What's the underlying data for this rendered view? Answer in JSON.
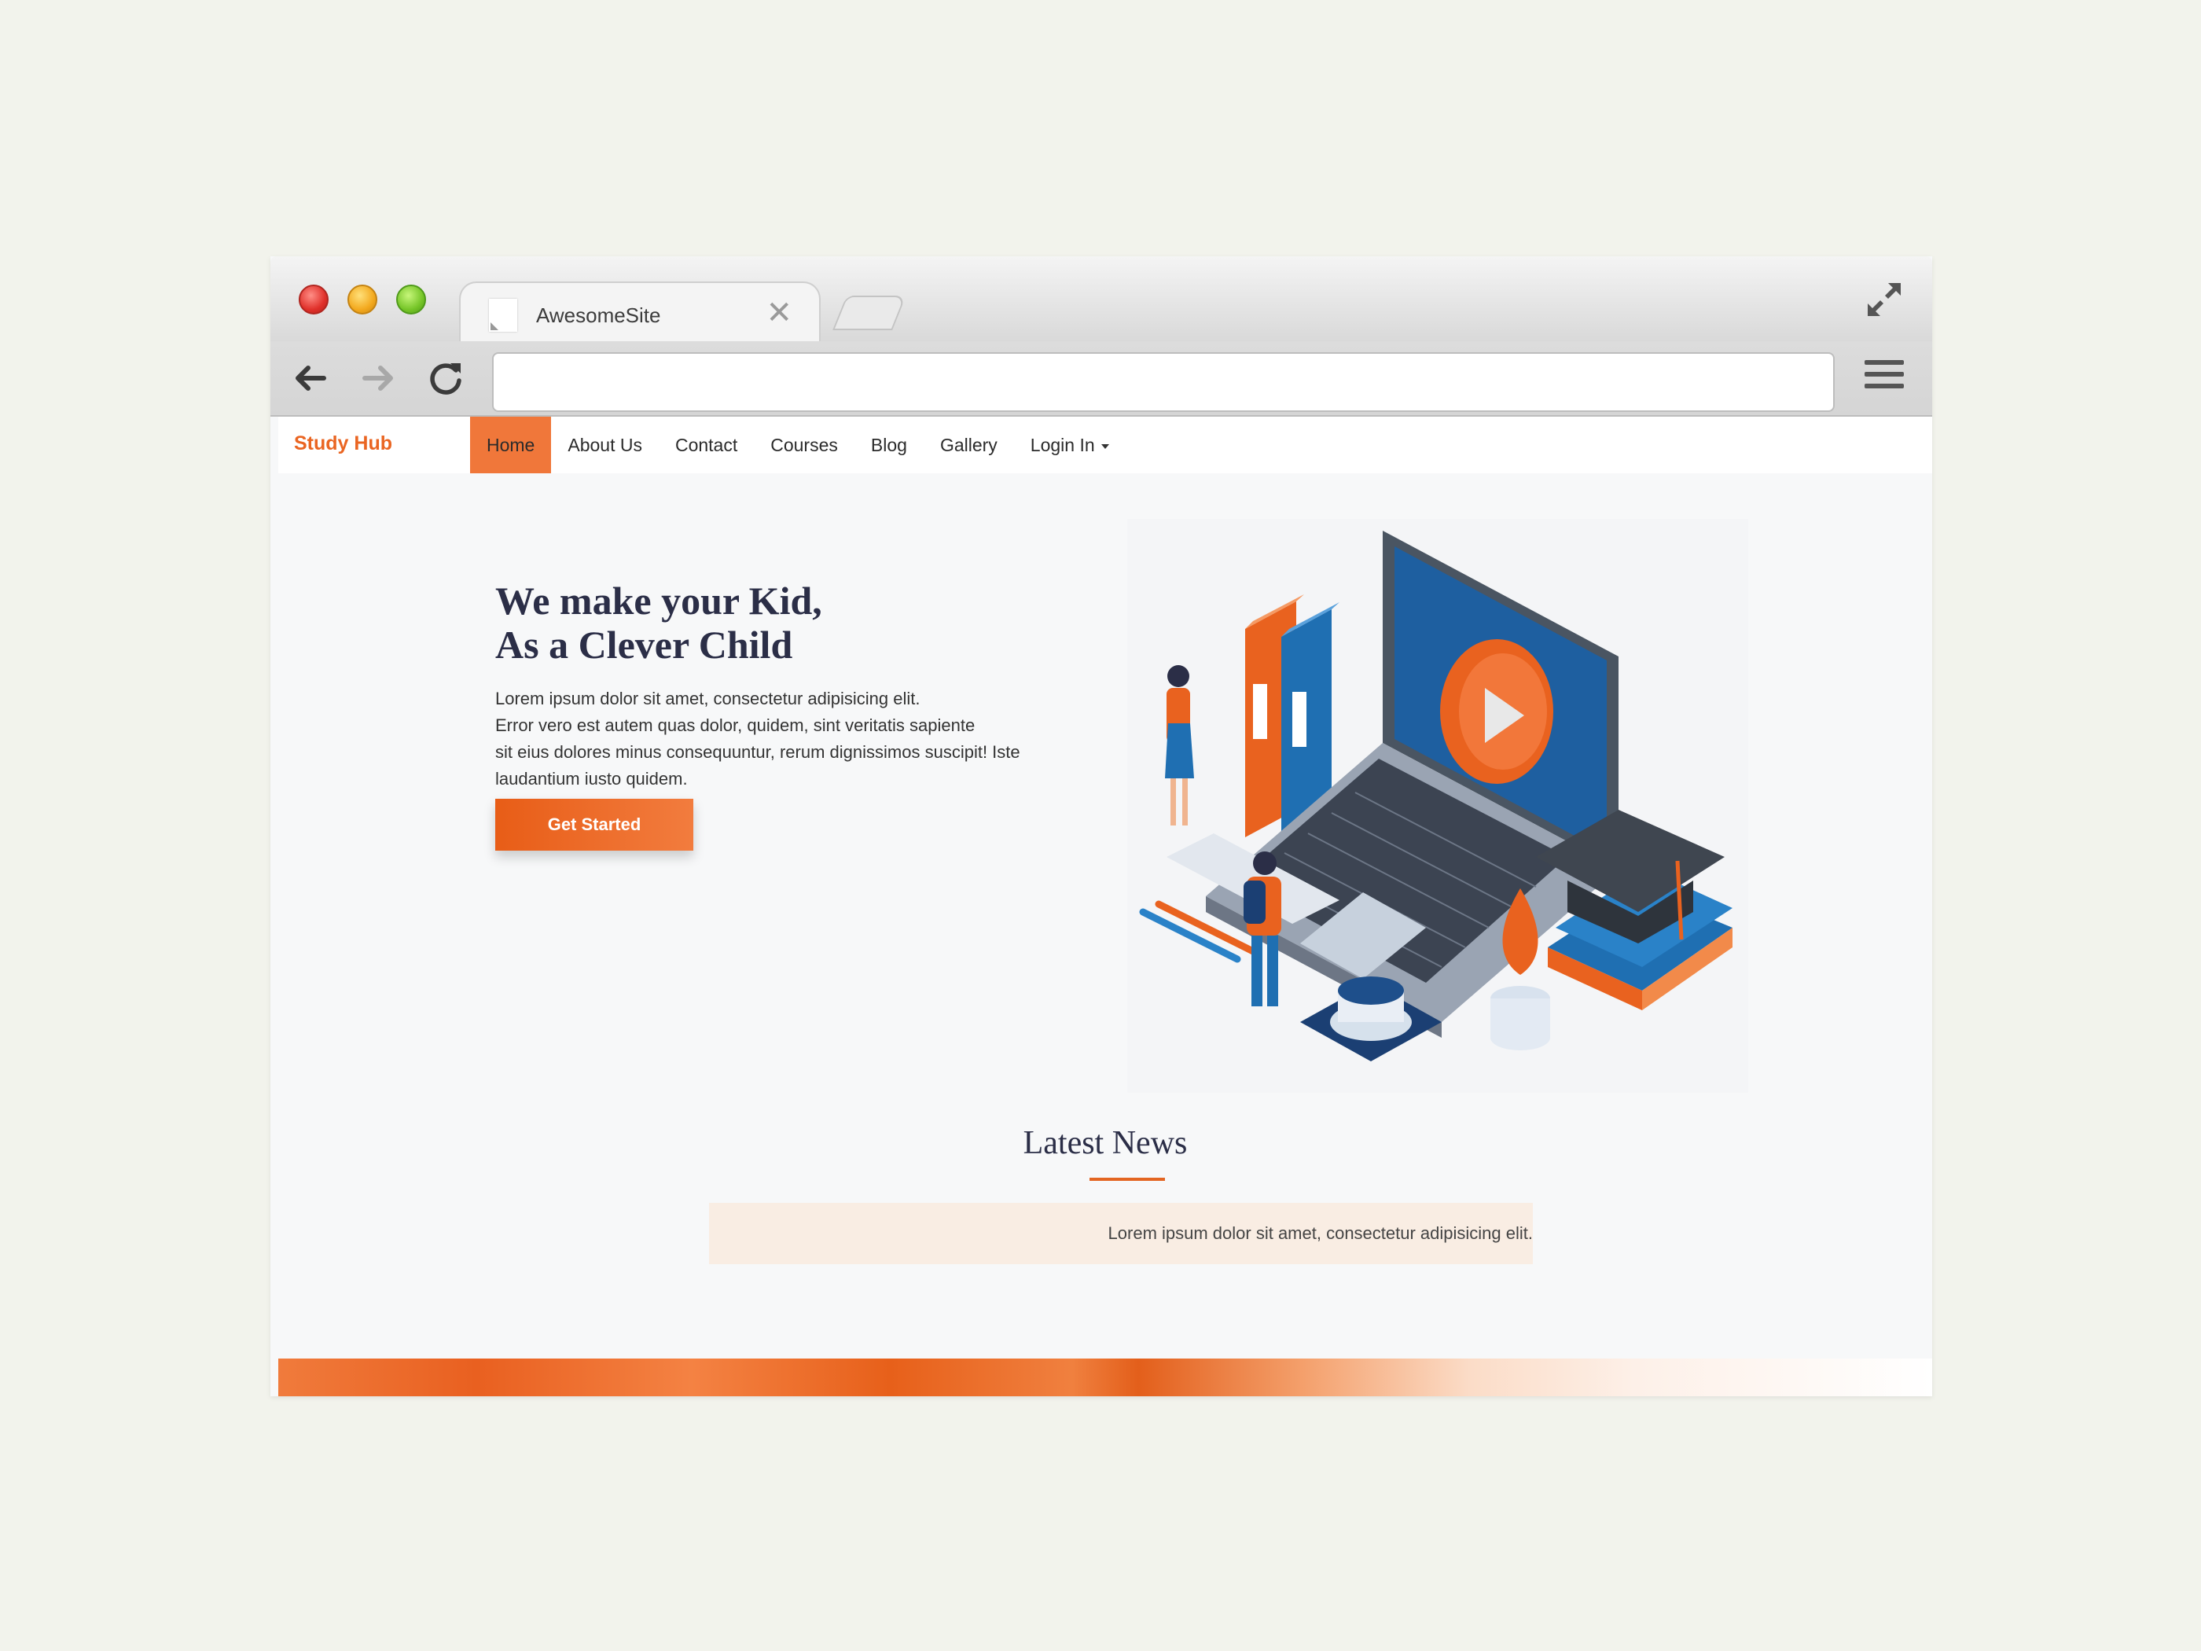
{
  "browser": {
    "tab_title": "AwesomeSite",
    "tab_close": "✕",
    "url": ""
  },
  "site": {
    "brand": "Study Hub",
    "nav": [
      "Home",
      "About Us",
      "Contact",
      "Courses",
      "Blog",
      "Gallery",
      "Login In"
    ],
    "active_nav": "Home",
    "hero": {
      "title_line1": "We make your Kid,",
      "title_line2": "As a Clever Child",
      "text_lines": [
        "Lorem ipsum dolor sit amet, consectetur adipisicing elit.",
        "Error vero est autem quas dolor, quidem, sint veritatis sapiente",
        "sit eius dolores minus consequuntur, rerum dignissimos suscipit! Iste",
        "laudantium iusto quidem."
      ],
      "cta": "Get Started"
    },
    "news": {
      "title": "Latest News",
      "ticker": "Lorem ipsum dolor sit amet, consectetur adipisicing elit."
    }
  },
  "colors": {
    "accent": "#e9621f",
    "heading": "#2b2e47",
    "page_bg": "#f7f8f9"
  }
}
